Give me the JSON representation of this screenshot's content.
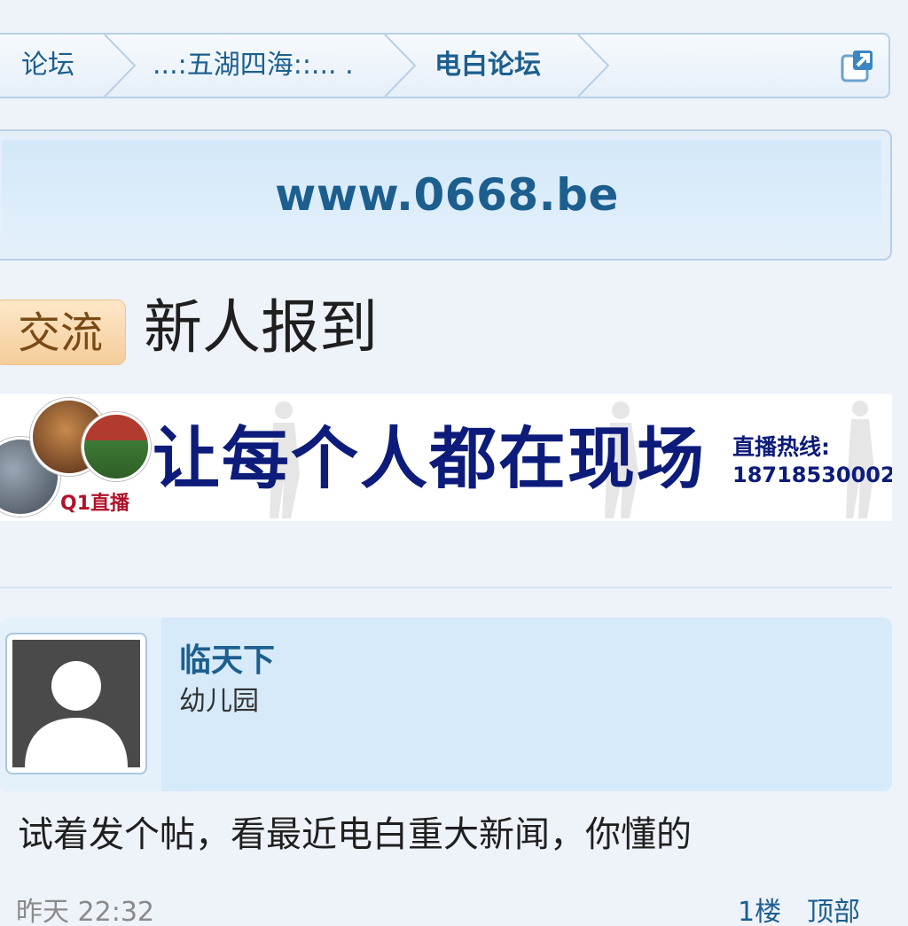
{
  "breadcrumb": {
    "items": [
      "论坛",
      "...:五湖四海::... .",
      "电白论坛"
    ]
  },
  "site": {
    "url": "www.0668.be"
  },
  "thread": {
    "category_badge": "交流",
    "title": "新人报到"
  },
  "ad_banner": {
    "slogan": "让每个人都在现场",
    "hotline_label": "直播热线:",
    "hotline_number": "18718530002",
    "logo_text": "Q1直播"
  },
  "post": {
    "author": "临天下",
    "user_group": "幼儿园",
    "content": "试着发个帖，看最近电白重大新闻，你懂的",
    "time": "昨天 22:32",
    "floor": "1楼",
    "to_top_label": "顶部"
  },
  "colors": {
    "link_blue": "#1c5f8f",
    "ad_navy": "#0d1c7a",
    "badge_orange": "#f5cd9b",
    "post_header_bg": "#d6eaf9"
  },
  "icons": [
    "chevron-right-icon",
    "popout-icon",
    "default-avatar-icon"
  ]
}
